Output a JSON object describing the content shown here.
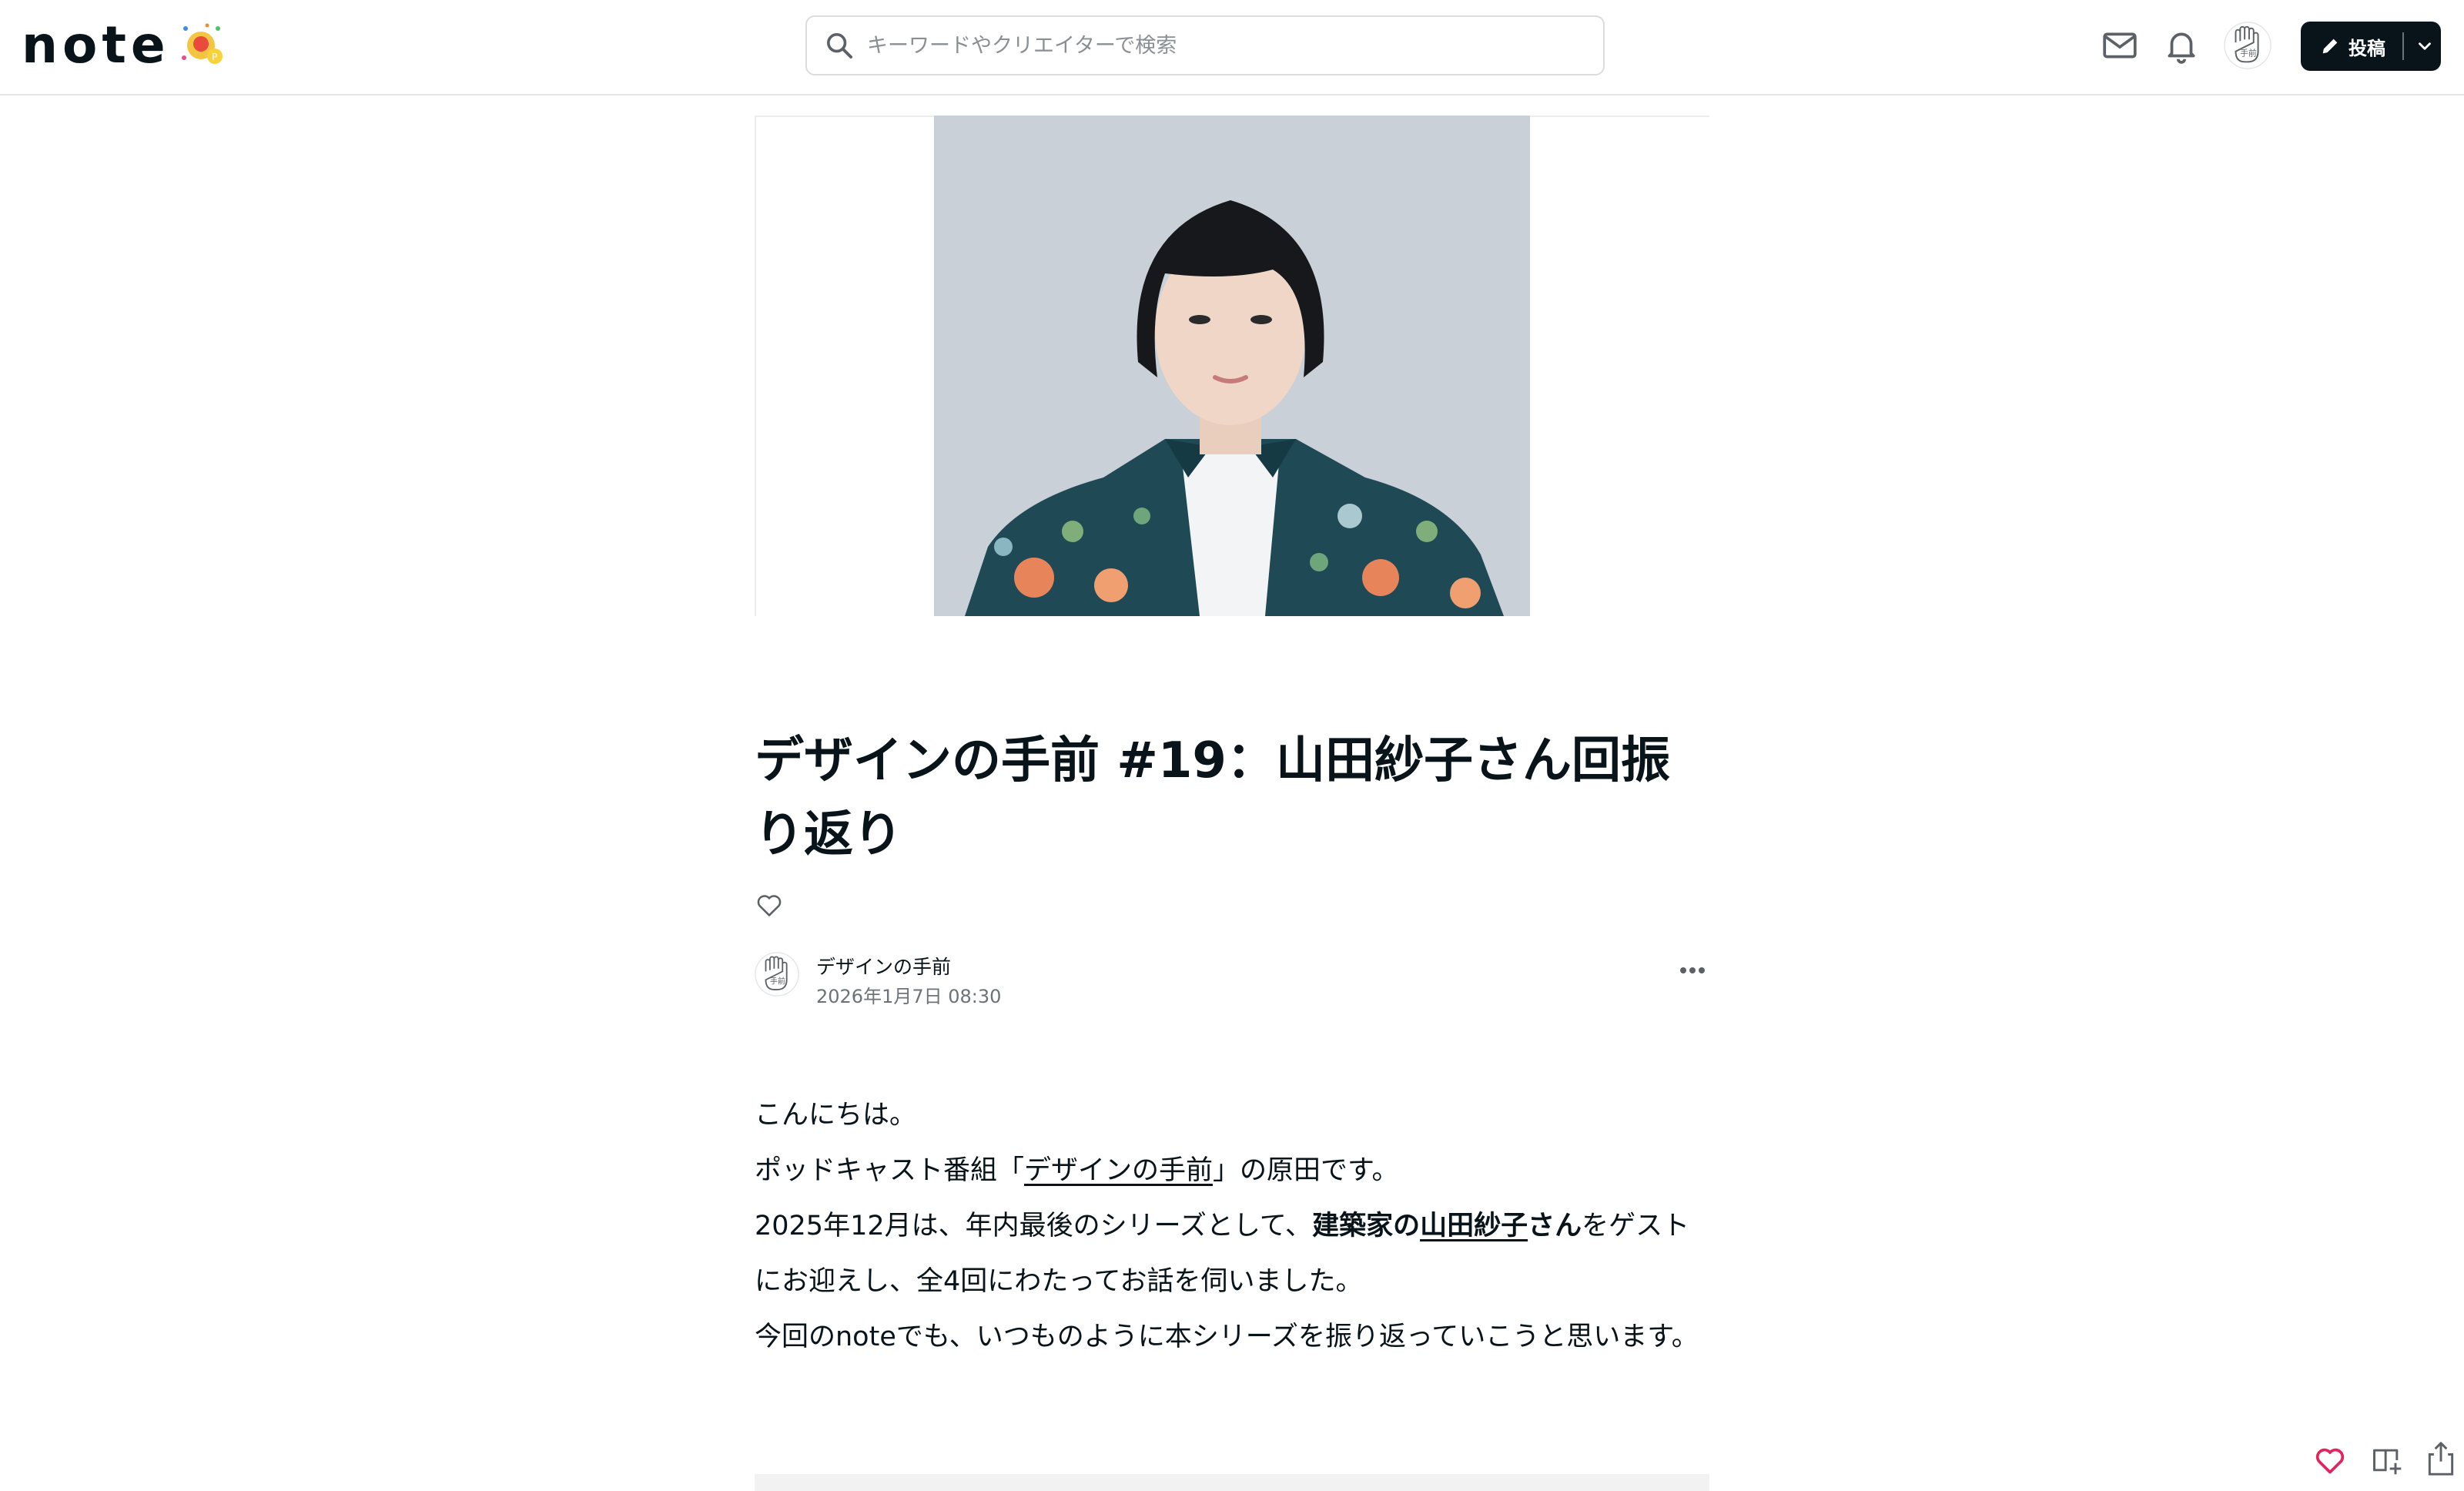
{
  "header": {
    "logo_text": "note",
    "search_placeholder": "キーワードやクリエイターで検索",
    "post_button_label": "投稿"
  },
  "article": {
    "title": "デザインの手前 #19：山田紗子さん回振り返り",
    "creator_name": "デザインの手前",
    "published_at": "2026年1月7日 08:30",
    "paragraphs": {
      "p1": "こんにちは。",
      "p2_before": "ポッドキャスト番組「",
      "p2_link": "デザインの手前",
      "p2_after": "」の原田です。",
      "p3_before": "2025年12月は、年内最後のシリーズとして、",
      "p3_bold1": "建築家の",
      "p3_link": "山田紗子",
      "p3_bold2": "さん",
      "p3_after": "をゲストにお迎えし、全4回にわたってお話を伺いました。",
      "p4": "今回のnoteでも、いつものように本シリーズを振り返っていこうと思います。"
    }
  },
  "icons": {
    "search": "search-icon",
    "mail": "mail-icon",
    "bell": "bell-icon",
    "heart": "heart-icon",
    "more": "more-icon",
    "magazine": "magazine-add-icon",
    "share": "share-icon"
  },
  "colors": {
    "brand_dark": "#08131a",
    "like_red": "#e0245e",
    "photo_bg": "#c9d0d8"
  }
}
